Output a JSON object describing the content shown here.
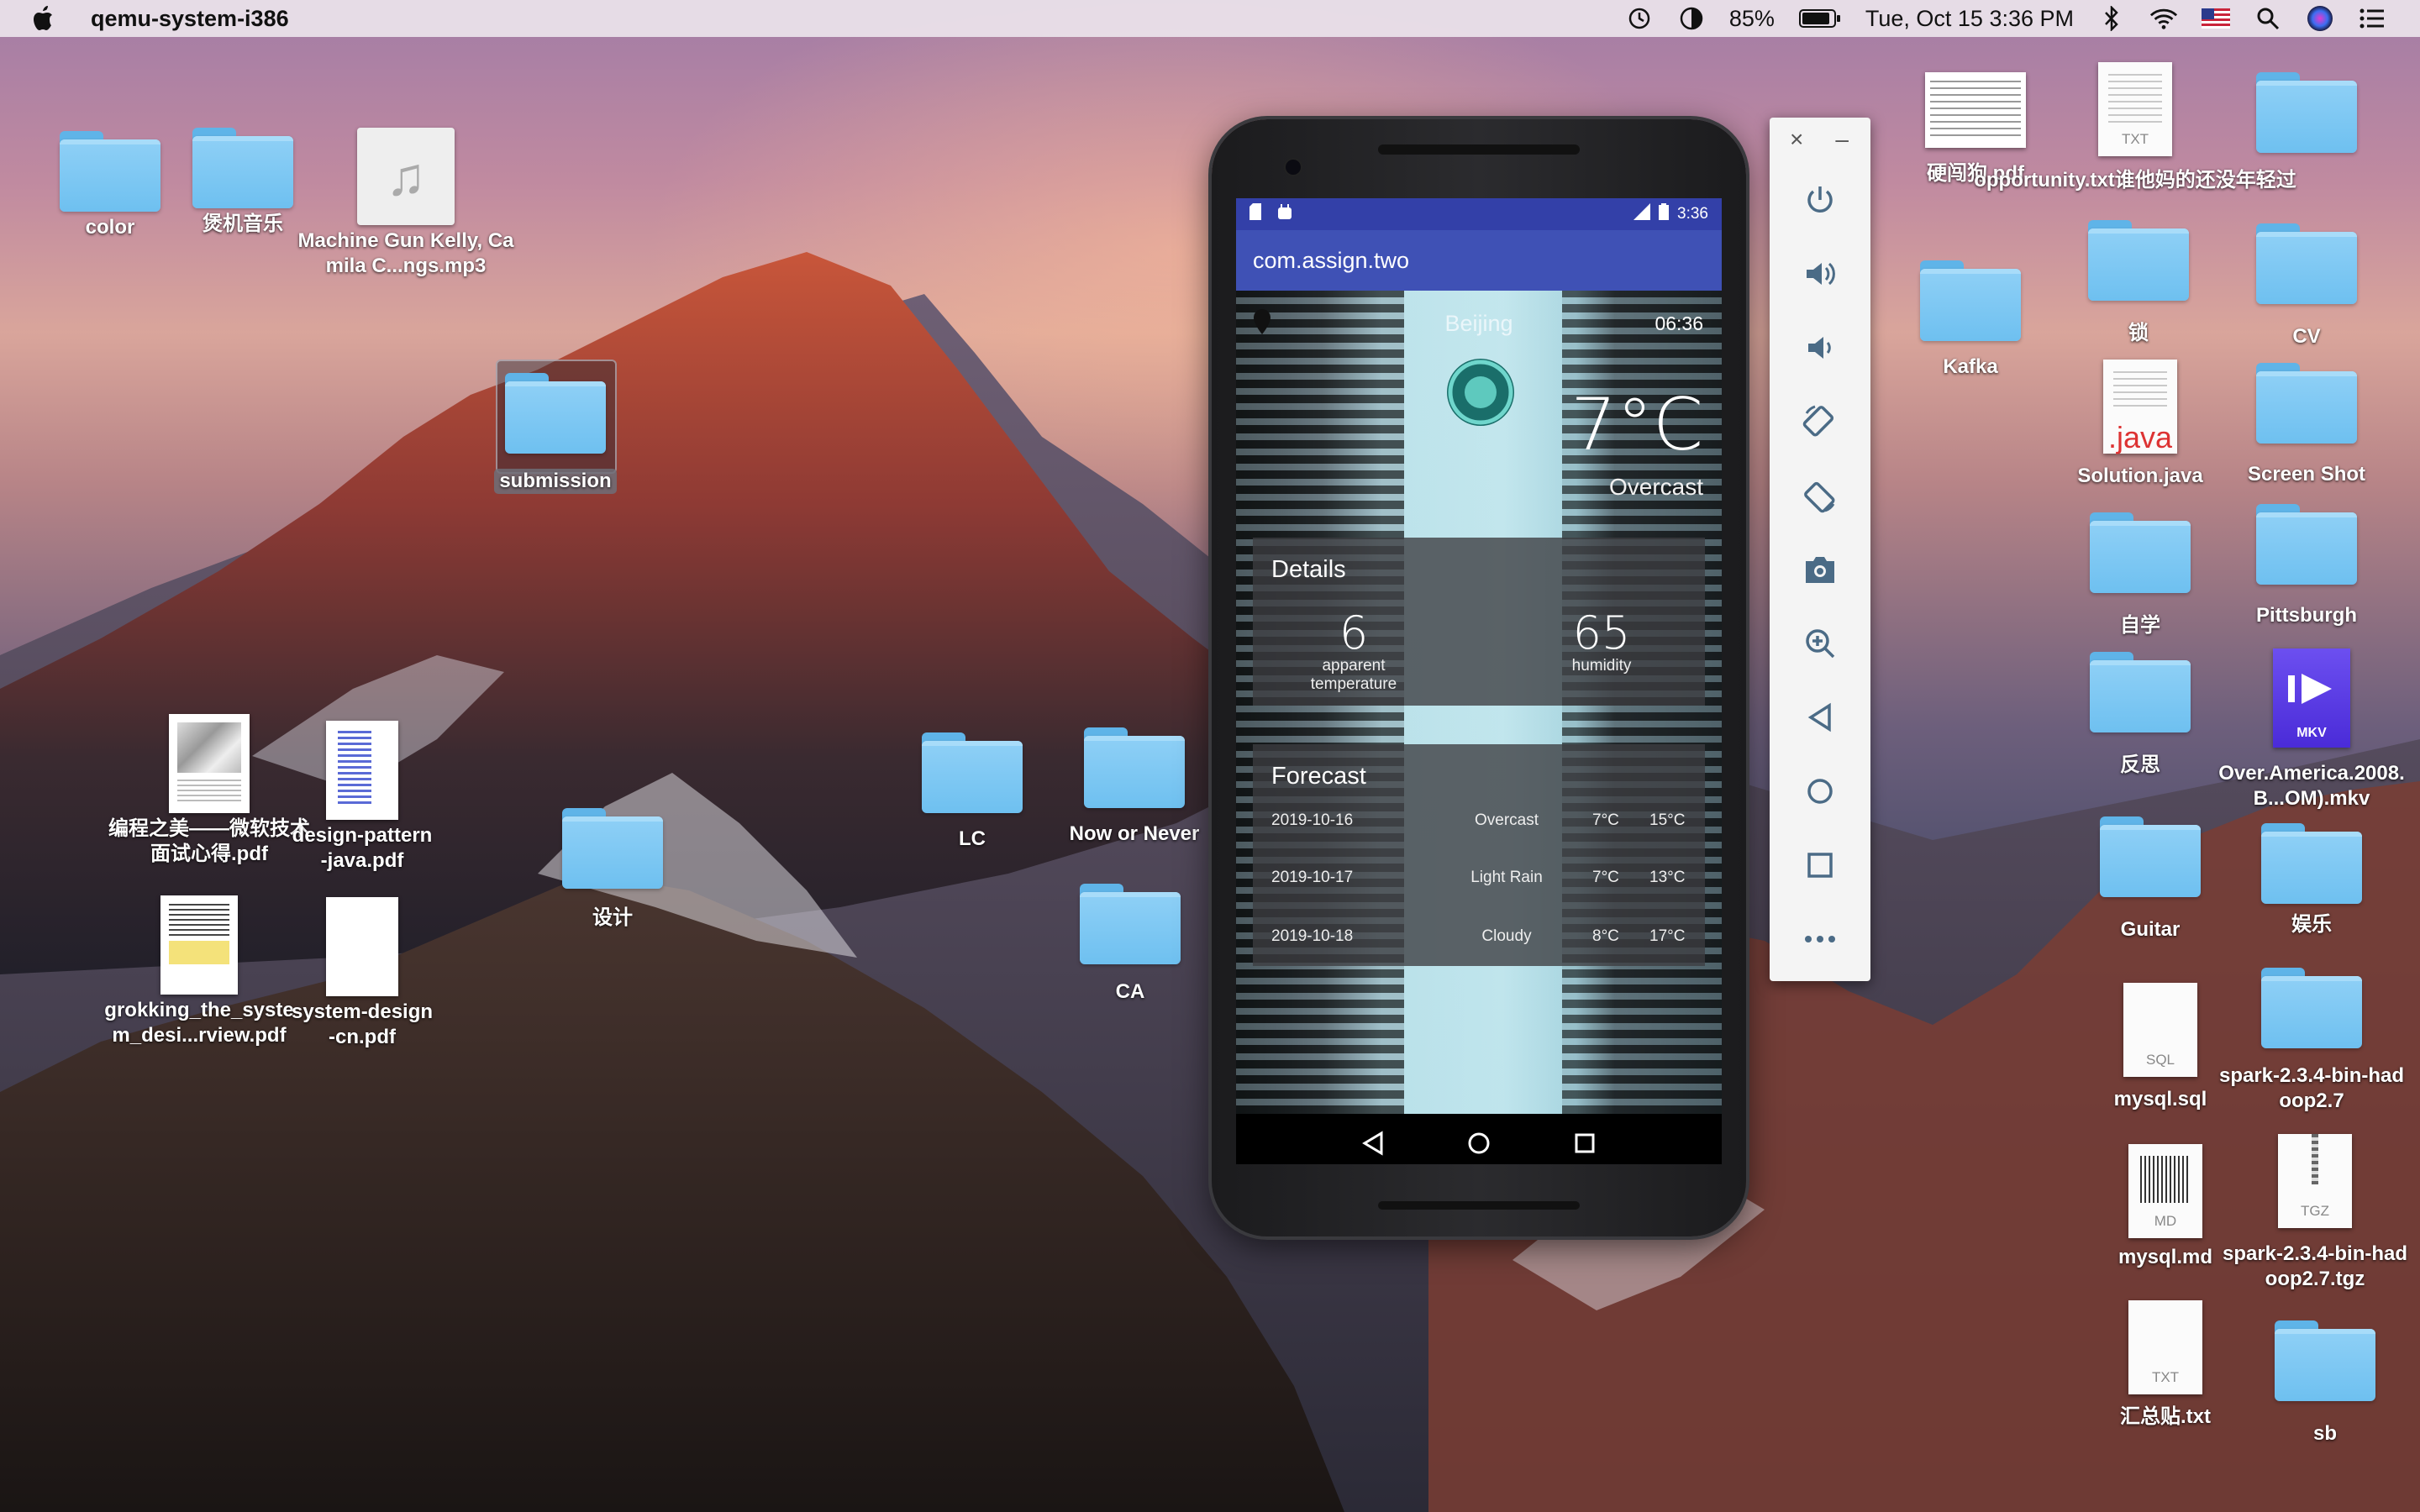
{
  "menubar": {
    "app_name": "qemu-system-i386",
    "battery": "85%",
    "clock": "Tue, Oct 15  3:36 PM"
  },
  "desktop_left": [
    {
      "label": "color",
      "type": "folder"
    },
    {
      "label": "煲机音乐",
      "type": "folder"
    },
    {
      "label": "Machine Gun Kelly, Camila C...ngs.mp3",
      "type": "audio"
    },
    {
      "label": "submission",
      "type": "folder"
    },
    {
      "label": "编程之美——微软技术面试心得.pdf",
      "type": "pdf"
    },
    {
      "label": "design-pattern-java.pdf",
      "type": "pdf"
    },
    {
      "label": "grokking_the_system_desi...rview.pdf",
      "type": "pdf"
    },
    {
      "label": "system-design-cn.pdf",
      "type": "pdf"
    },
    {
      "label": "设计",
      "type": "folder"
    },
    {
      "label": "LC",
      "type": "folder"
    },
    {
      "label": "Now or Never",
      "type": "folder"
    },
    {
      "label": "CA",
      "type": "folder"
    }
  ],
  "desktop_right": [
    {
      "label": "硬闯狗.pdf",
      "type": "pdf"
    },
    {
      "label": "opportunity.txt谁他妈的还没年轻过",
      "type": "txt",
      "ext": "TXT"
    },
    {
      "label": "",
      "type": "folder"
    },
    {
      "label": "Kafka",
      "type": "folder"
    },
    {
      "label": "锁",
      "type": "folder"
    },
    {
      "label": "CV",
      "type": "folder"
    },
    {
      "label": "Solution.java",
      "type": "java",
      "ext": ".java"
    },
    {
      "label": "Screen Shot",
      "type": "folder"
    },
    {
      "label": "自学",
      "type": "folder"
    },
    {
      "label": "Pittsburgh",
      "type": "folder"
    },
    {
      "label": "反思",
      "type": "folder"
    },
    {
      "label": "Over.America.2008.B...OM).mkv",
      "type": "video",
      "ext": "MKV"
    },
    {
      "label": "Guitar",
      "type": "folder"
    },
    {
      "label": "娱乐",
      "type": "folder"
    },
    {
      "label": "mysql.sql",
      "type": "sql",
      "ext": "SQL"
    },
    {
      "label": "spark-2.3.4-bin-hadoop2.7",
      "type": "folder"
    },
    {
      "label": "mysql.md",
      "type": "md",
      "ext": "MD"
    },
    {
      "label": "spark-2.3.4-bin-hadoop2.7.tgz",
      "type": "tgz",
      "ext": "TGZ"
    },
    {
      "label": "汇总贴.txt",
      "type": "txt",
      "ext": "TXT"
    },
    {
      "label": "sb",
      "type": "folder"
    }
  ],
  "phone": {
    "status_time": "3:36",
    "app_title": "com.assign.two",
    "city": "Beijing",
    "update_time": "06:36",
    "temperature": "7°C",
    "condition": "Overcast",
    "details_title": "Details",
    "details": [
      {
        "value": "6",
        "label": "apparent temperature"
      },
      {
        "value": "65",
        "label": "humidity"
      }
    ],
    "forecast_title": "Forecast",
    "forecast": [
      {
        "date": "2019-10-16",
        "condition": "Overcast",
        "low": "7°C",
        "high": "15°C"
      },
      {
        "date": "2019-10-17",
        "condition": "Light Rain",
        "low": "7°C",
        "high": "13°C"
      },
      {
        "date": "2019-10-18",
        "condition": "Cloudy",
        "low": "8°C",
        "high": "17°C"
      }
    ]
  },
  "emulator_toolbar": [
    "close-icon",
    "minimize-icon",
    "power-icon",
    "volume-up-icon",
    "volume-down-icon",
    "rotate-left-icon",
    "rotate-right-icon",
    "camera-icon",
    "zoom-icon",
    "back-icon",
    "home-icon",
    "overview-icon",
    "more-icon"
  ]
}
